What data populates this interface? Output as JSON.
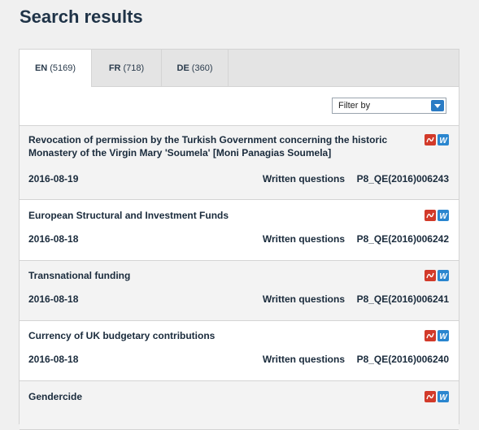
{
  "page": {
    "title": "Search results"
  },
  "tabs": [
    {
      "code": "EN",
      "count": "(5169)",
      "active": true
    },
    {
      "code": "FR",
      "count": "(718)",
      "active": false
    },
    {
      "code": "DE",
      "count": "(360)",
      "active": false
    }
  ],
  "filter": {
    "label": "Filter by"
  },
  "results": [
    {
      "title": "Revocation of permission by the Turkish Government concerning the historic Monastery of the Virgin Mary 'Soumela' [Moni Panagias Soumela]",
      "date": "2016-08-19",
      "type": "Written questions",
      "ref": "P8_QE(2016)006243"
    },
    {
      "title": "European Structural and Investment Funds",
      "date": "2016-08-18",
      "type": "Written questions",
      "ref": "P8_QE(2016)006242"
    },
    {
      "title": "Transnational funding",
      "date": "2016-08-18",
      "type": "Written questions",
      "ref": "P8_QE(2016)006241"
    },
    {
      "title": "Currency of UK budgetary contributions",
      "date": "2016-08-18",
      "type": "Written questions",
      "ref": "P8_QE(2016)006240"
    },
    {
      "title": "Gendercide",
      "date": "",
      "type": "",
      "ref": ""
    }
  ],
  "icons": {
    "pdf": "pdf-icon",
    "word": "word-icon",
    "word_glyph": "W"
  },
  "colors": {
    "pdf": "#d23a2a",
    "word": "#2a86cf",
    "accent": "#2a7bc4"
  }
}
